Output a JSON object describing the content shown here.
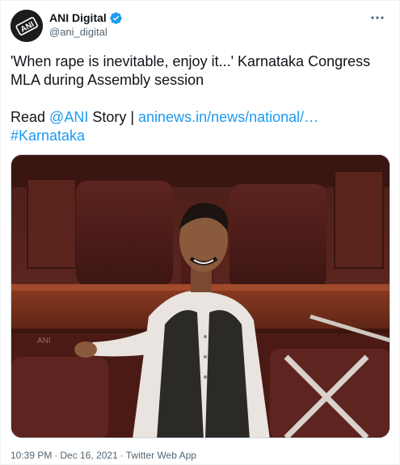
{
  "user": {
    "display_name": "ANI Digital",
    "handle": "@ani_digital",
    "avatar_text": "ANI",
    "verified_icon": "verified-badge-icon"
  },
  "tweet": {
    "line1": "'When rape is inevitable, enjoy it...' Karnataka Congress MLA during Assembly session",
    "read_prefix": "Read ",
    "mention": "@ANI",
    "story_text": " Story | ",
    "url": "aninews.in/news/national/…",
    "hashtag": "#Karnataka"
  },
  "media": {
    "watermark": "ANI"
  },
  "meta": {
    "time": "10:39 PM",
    "date": "Dec 16, 2021",
    "separator": "·",
    "source": "Twitter Web App"
  },
  "colors": {
    "link": "#1d9bf0",
    "secondary_text": "#536471",
    "primary_text": "#0f1419",
    "verified": "#1d9bf0"
  }
}
